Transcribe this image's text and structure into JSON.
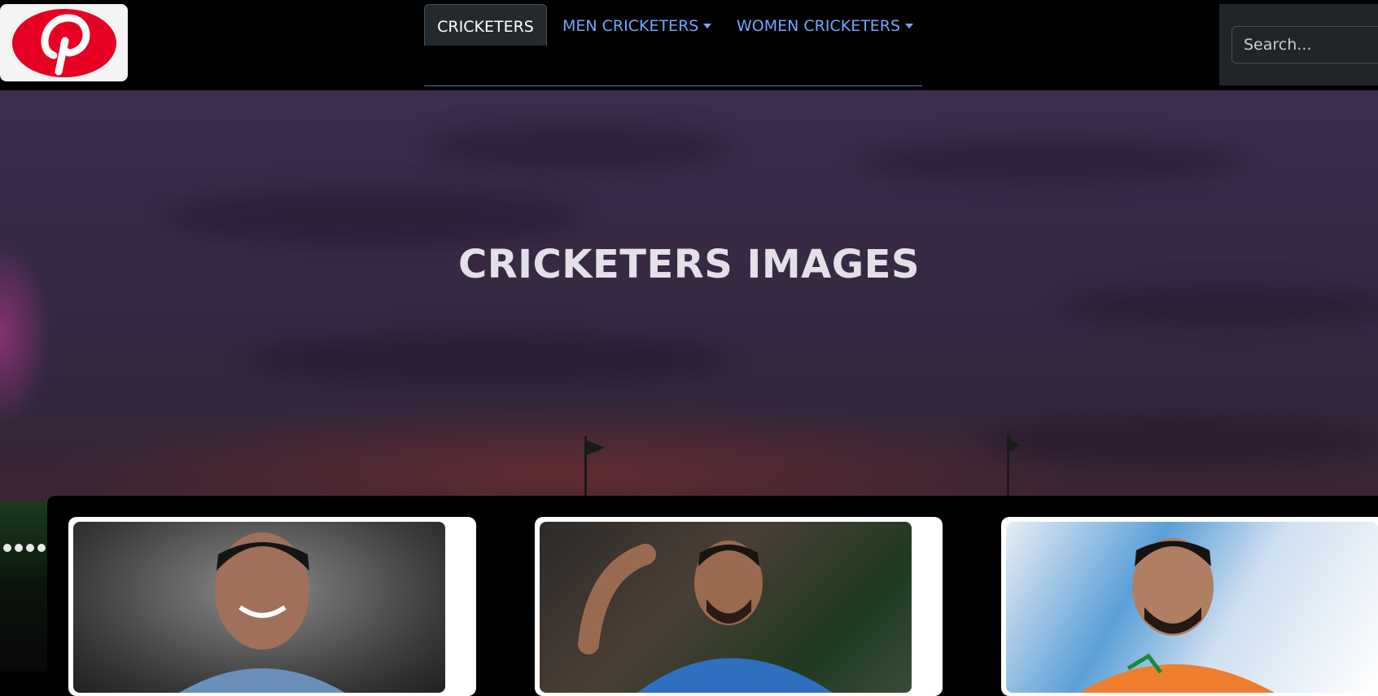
{
  "navbar": {
    "logo_alt": "Pinterest",
    "tabs": [
      {
        "label": "CRICKETERS",
        "active": true,
        "dropdown": false
      },
      {
        "label": "MEN CRICKETERS",
        "active": false,
        "dropdown": true
      },
      {
        "label": "WOMEN CRICKETERS",
        "active": false,
        "dropdown": true
      }
    ],
    "search": {
      "placeholder": "Search..."
    }
  },
  "hero": {
    "title": "CRICKETERS IMAGES"
  },
  "cards": [
    {
      "image": "cricketer-photo-smiling-player"
    },
    {
      "image": "cricketer-photo-flexing-arm"
    },
    {
      "image": "cricketer-photo-bearded-player"
    }
  ],
  "colors": {
    "link": "#6ea8fe",
    "active_tab_bg": "#24292d",
    "brand_red": "#e60023"
  }
}
